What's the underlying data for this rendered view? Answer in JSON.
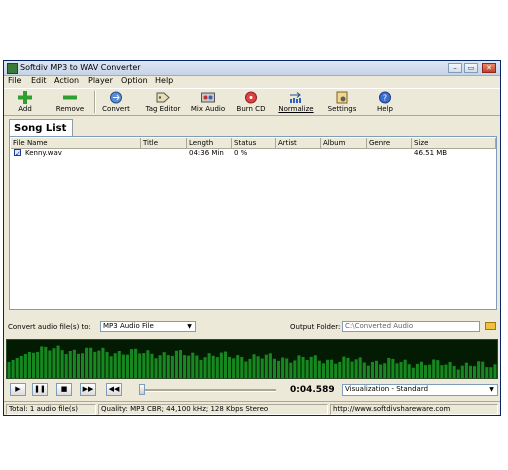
{
  "window": {
    "title": "Softdiv MP3 to WAV Converter",
    "controls": [
      "–",
      "▭",
      "✕"
    ]
  },
  "menu": [
    "File",
    "Edit",
    "Action",
    "Player",
    "Option",
    "Help"
  ],
  "toolbar": {
    "add": "Add",
    "remove": "Remove",
    "convert": "Convert",
    "tag_editor": "Tag Editor",
    "mix_audio": "Mix Audio",
    "burn_cd": "Burn CD",
    "normalize": "Normalize",
    "settings": "Settings",
    "help": "Help"
  },
  "tab": "Song List",
  "columns": [
    "File Name",
    "Title",
    "Length",
    "Status",
    "Artist",
    "Album",
    "Genre",
    "Size"
  ],
  "rows": [
    {
      "file_name": "Kenny.wav",
      "title": "",
      "length": "04:36 Min",
      "status": "0 %",
      "artist": "",
      "album": "",
      "genre": "",
      "size": "46.51 MB",
      "checked": true
    }
  ],
  "convert": {
    "label": "Convert audio file(s) to:",
    "format": "MP3 Audio File",
    "output_label": "Output Folder:",
    "output_folder": "C:\\Converted Audio"
  },
  "player": {
    "time": "0:04.589",
    "visualization": "Visualization - Standard",
    "buttons": [
      "▶",
      "❚❚",
      "■",
      "▶▶",
      "◀◀"
    ],
    "progress": 0.0
  },
  "statusbar": {
    "total": "Total: 1 audio file(s)",
    "quality": "Quality: MP3 CBR; 44,100 kHz; 128 Kbps Stereo",
    "url": "http://www.softdivshareware.com"
  },
  "colors": {
    "viz_bg": "#031a03",
    "viz_bar": "#1fae2a",
    "accent": "#0a246a"
  }
}
